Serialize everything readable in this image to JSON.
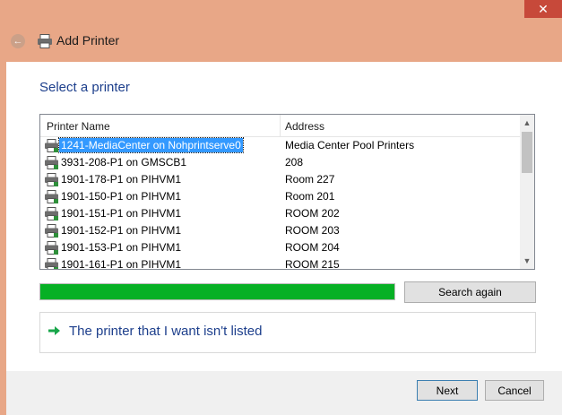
{
  "window": {
    "title": "Add Printer",
    "close_glyph": "✕",
    "back_glyph": "←"
  },
  "main": {
    "heading": "Select a printer",
    "columns": {
      "name": "Printer Name",
      "address": "Address"
    },
    "printers": [
      {
        "name": "1241-MediaCenter on Nohprintserve0",
        "address": "Media Center Pool Printers",
        "selected": true
      },
      {
        "name": "3931-208-P1 on GMSCB1",
        "address": "208"
      },
      {
        "name": "1901-178-P1 on PIHVM1",
        "address": "Room 227"
      },
      {
        "name": "1901-150-P1 on PIHVM1",
        "address": "Room 201"
      },
      {
        "name": "1901-151-P1 on PIHVM1",
        "address": "ROOM 202"
      },
      {
        "name": "1901-152-P1 on PIHVM1",
        "address": "ROOM 203"
      },
      {
        "name": "1901-153-P1 on PIHVM1",
        "address": "ROOM 204"
      },
      {
        "name": "1901-161-P1 on PIHVM1",
        "address": "ROOM 215"
      }
    ],
    "progress_percent": 100,
    "search_again_label": "Search again",
    "not_listed_label": "The printer that I want isn't listed"
  },
  "footer": {
    "next_label": "Next",
    "cancel_label": "Cancel"
  },
  "colors": {
    "accent_link": "#1d3f8c",
    "progress": "#06b025",
    "selection": "#3399ff",
    "window_frame": "#e8a787"
  }
}
